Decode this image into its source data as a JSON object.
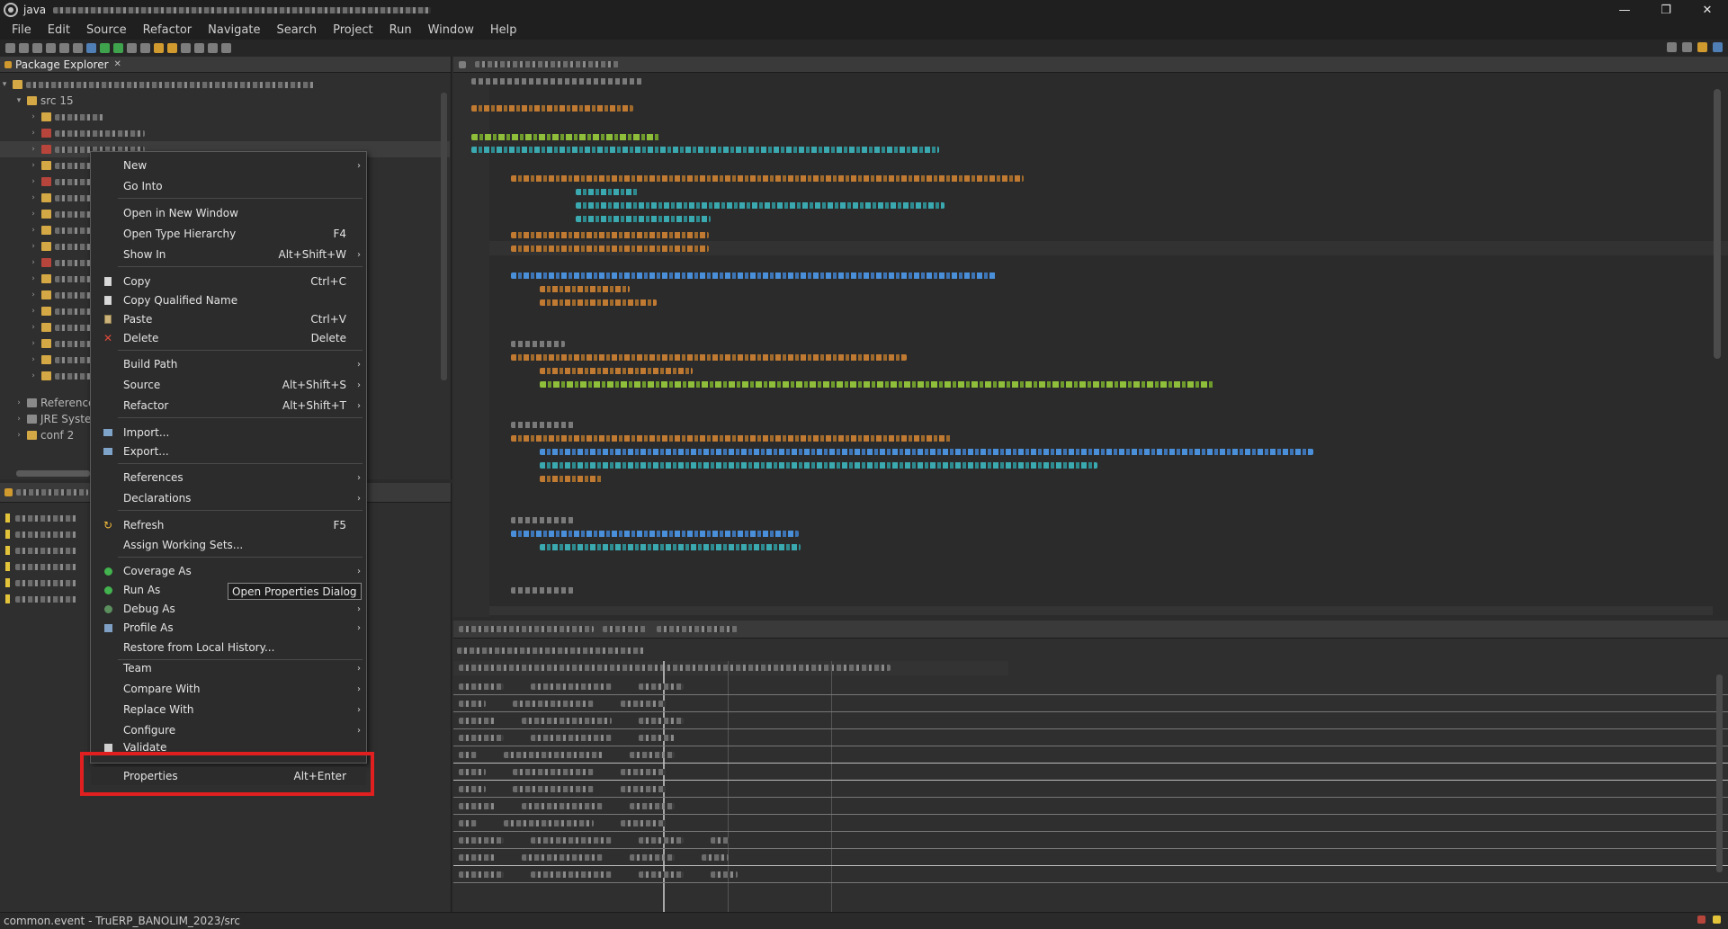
{
  "window": {
    "title": "java",
    "controls": [
      "—",
      "❐",
      "✕"
    ]
  },
  "menubar": [
    "File",
    "Edit",
    "Source",
    "Refactor",
    "Navigate",
    "Search",
    "Project",
    "Run",
    "Window",
    "Help"
  ],
  "package_explorer": {
    "tab_label": "Package Explorer",
    "tree": [
      {
        "label": "src 15",
        "icon": "folder-icon"
      },
      {
        "label": "Reference",
        "icon": "library-icon"
      },
      {
        "label": "JRE Syste",
        "icon": "library-icon"
      },
      {
        "label": "conf 2",
        "icon": "folder-icon"
      }
    ]
  },
  "context_menu": {
    "items": [
      {
        "label": "New",
        "submenu": true
      },
      {
        "label": "Go Into"
      },
      {
        "label": "Open in New Window"
      },
      {
        "label": "Open Type Hierarchy",
        "shortcut": "F4"
      },
      {
        "label": "Show In",
        "shortcut": "Alt+Shift+W",
        "submenu": true
      },
      {
        "label": "Copy",
        "shortcut": "Ctrl+C",
        "icon": "copy-icon"
      },
      {
        "label": "Copy Qualified Name",
        "icon": "copy-icon"
      },
      {
        "label": "Paste",
        "shortcut": "Ctrl+V",
        "icon": "paste-icon"
      },
      {
        "label": "Delete",
        "shortcut": "Delete",
        "icon": "delete-icon"
      },
      {
        "label": "Build Path",
        "submenu": true
      },
      {
        "label": "Source",
        "shortcut": "Alt+Shift+S",
        "submenu": true
      },
      {
        "label": "Refactor",
        "shortcut": "Alt+Shift+T",
        "submenu": true
      },
      {
        "label": "Import...",
        "icon": "import-icon"
      },
      {
        "label": "Export...",
        "icon": "export-icon"
      },
      {
        "label": "References",
        "submenu": true
      },
      {
        "label": "Declarations",
        "submenu": true
      },
      {
        "label": "Refresh",
        "shortcut": "F5",
        "icon": "refresh-icon"
      },
      {
        "label": "Assign Working Sets..."
      },
      {
        "label": "Coverage As",
        "submenu": true,
        "icon": "coverage-icon"
      },
      {
        "label": "Run As",
        "submenu": true,
        "icon": "run-icon"
      },
      {
        "label": "Debug As",
        "submenu": true,
        "icon": "debug-icon"
      },
      {
        "label": "Profile As",
        "submenu": true,
        "icon": "profile-icon"
      },
      {
        "label": "Restore from Local History..."
      },
      {
        "label": "Team",
        "submenu": true
      },
      {
        "label": "Compare With",
        "submenu": true
      },
      {
        "label": "Replace With",
        "submenu": true
      },
      {
        "label": "Configure",
        "submenu": true
      },
      {
        "label": "Validate",
        "icon": "validate-icon"
      },
      {
        "label": "Properties",
        "shortcut": "Alt+Enter"
      }
    ],
    "tooltip": "Open Properties Dialog"
  },
  "statusbar": {
    "text": "common.event - TruERP_BANOLIM_2023/src"
  },
  "colors": {
    "highlight": "#e02020",
    "background": "#2b2b2b"
  }
}
